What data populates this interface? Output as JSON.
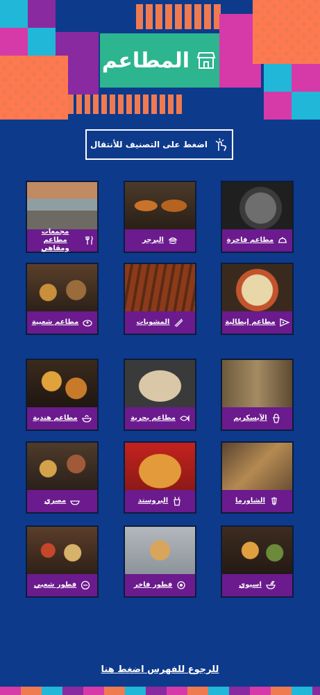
{
  "header": {
    "title": "المطاعم",
    "icon": "shop-icon"
  },
  "hint": {
    "label": "اضغط على التصنيف للأنتقال",
    "icon": "tap-hand-icon"
  },
  "categories": [
    {
      "label": "مطاعم فاخرة",
      "icon": "dish-cover-icon"
    },
    {
      "label": "البرجر",
      "icon": "burger-icon"
    },
    {
      "label": "مجمعات مطاعم ومقاهي",
      "icon": "fork-knife-icon"
    },
    {
      "label": "مطاعم إيطالية",
      "icon": "pizza-icon"
    },
    {
      "label": "المشويات",
      "icon": "skewer-icon"
    },
    {
      "label": "مطاعم شعبية",
      "icon": "platter-icon"
    },
    {
      "label": "الآيسكريم",
      "icon": "ice-cream-icon"
    },
    {
      "label": "مطاعم بحرية",
      "icon": "fish-icon"
    },
    {
      "label": "مطاعم هندية",
      "icon": "curry-bowl-icon"
    },
    {
      "label": "الشاورما",
      "icon": "shawarma-icon"
    },
    {
      "label": "البروستد",
      "icon": "fried-chicken-icon"
    },
    {
      "label": "مصري",
      "icon": "bowl-icon"
    },
    {
      "label": "اسيوي",
      "icon": "noodle-bowl-icon"
    },
    {
      "label": "فطور فاخر",
      "icon": "breakfast-plate-icon"
    },
    {
      "label": "فطور شعبي",
      "icon": "breakfast-bowl-icon"
    }
  ],
  "footer": {
    "back_label": "للرجوع للفهرس اضغط هنا"
  },
  "colors": {
    "background": "#0e3a8c",
    "label_bg": "#6b1b8d",
    "title_bg": "#2db58f",
    "pink": "#d63aa8",
    "orange": "#f07a50",
    "cyan": "#20b7d8"
  }
}
